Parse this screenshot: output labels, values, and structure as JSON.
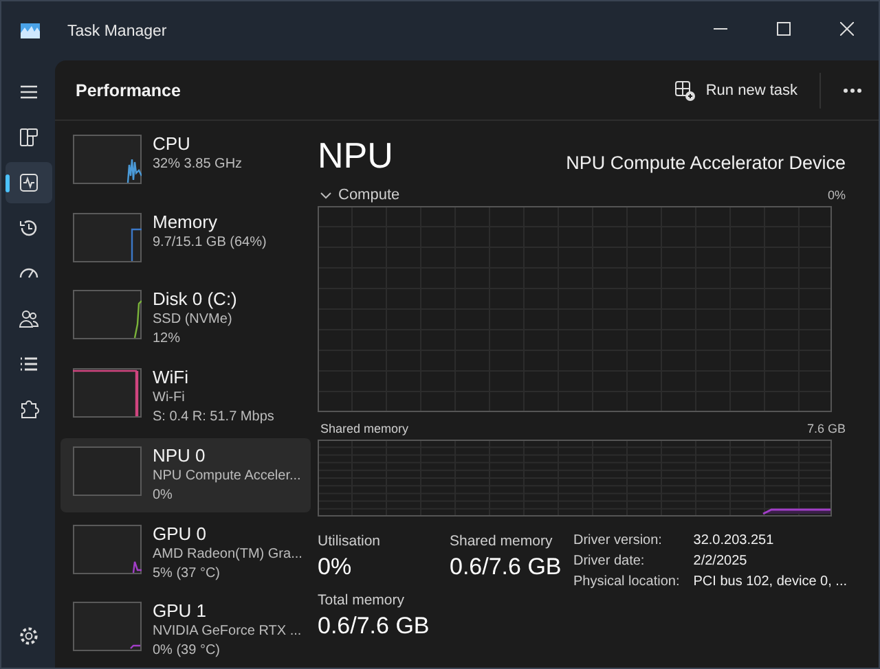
{
  "window": {
    "title": "Task Manager"
  },
  "nav_items": [
    {
      "kind": "menu",
      "selected": false
    },
    {
      "kind": "processes",
      "selected": false
    },
    {
      "kind": "performance",
      "selected": true
    },
    {
      "kind": "history",
      "selected": false
    },
    {
      "kind": "startup",
      "selected": false
    },
    {
      "kind": "users",
      "selected": false
    },
    {
      "kind": "details",
      "selected": false
    },
    {
      "kind": "services",
      "selected": false
    },
    {
      "kind": "settings",
      "selected": false
    }
  ],
  "header": {
    "title": "Performance",
    "run_button": "Run new task"
  },
  "devices": [
    {
      "name": "CPU",
      "lines": [
        "32%  3.85 GHz"
      ],
      "color": "#4a9ad8",
      "selected": false
    },
    {
      "name": "Memory",
      "lines": [
        "9.7/15.1 GB (64%)"
      ],
      "color": "#3b78c8",
      "selected": false
    },
    {
      "name": "Disk 0 (C:)",
      "lines": [
        "SSD (NVMe)",
        "12%"
      ],
      "color": "#7ab33a",
      "selected": false
    },
    {
      "name": "WiFi",
      "lines": [
        "Wi-Fi",
        "S: 0.4 R: 51.7 Mbps"
      ],
      "color": "#d0457f",
      "selected": false
    },
    {
      "name": "NPU 0",
      "lines": [
        "NPU Compute Acceler...",
        "0%"
      ],
      "selected": true
    },
    {
      "name": "GPU 0",
      "lines": [
        "AMD Radeon(TM) Gra...",
        "5% (37 °C)"
      ],
      "color": "#a23ec8",
      "selected": false
    },
    {
      "name": "GPU 1",
      "lines": [
        "NVIDIA GeForce RTX ...",
        "0% (39 °C)"
      ],
      "color": "#a23ec8",
      "selected": false
    }
  ],
  "detail": {
    "title": "NPU",
    "device_name": "NPU Compute Accelerator Device",
    "compute_label": "Compute",
    "compute_max": "0%",
    "shared_label": "Shared memory",
    "shared_max": "7.6 GB",
    "stats": [
      {
        "label": "Utilisation",
        "value": "0%"
      },
      {
        "label": "Shared memory",
        "value": "0.6/7.6 GB"
      },
      {
        "label": "Total memory",
        "value": "0.6/7.6 GB"
      }
    ],
    "properties": [
      {
        "label": "Driver version:",
        "value": "32.0.203.251"
      },
      {
        "label": "Driver date:",
        "value": "2/2/2025"
      },
      {
        "label": "Physical location:",
        "value": "PCI bus 102, device 0, ..."
      }
    ]
  }
}
